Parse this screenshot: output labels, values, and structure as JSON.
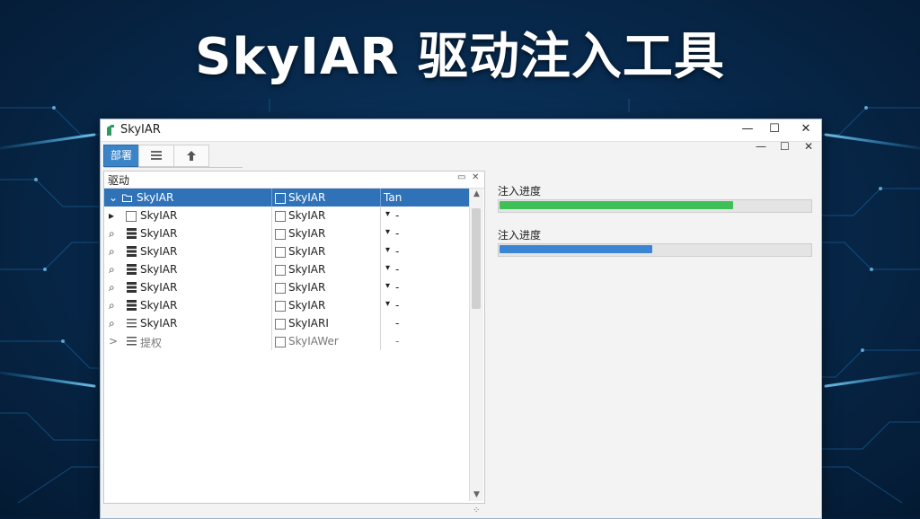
{
  "headline": "SkyIAR 驱动注入工具",
  "window": {
    "title": "SkyIAR",
    "controls": {
      "minimize": "—",
      "maximize": "☐",
      "close": "✕"
    },
    "inner_controls": {
      "minimize": "—",
      "maximize": "☐",
      "close": "✕"
    }
  },
  "toolbar": {
    "tabs": [
      {
        "label": "部署",
        "icon": null,
        "active": true
      },
      {
        "label": "",
        "icon": "list-icon",
        "active": false
      },
      {
        "label": "",
        "icon": "upload-icon",
        "active": false
      }
    ]
  },
  "driver_panel": {
    "title": "驱动",
    "controls": {
      "pin": "▭",
      "close": "✕"
    },
    "rows": [
      {
        "expander": "⌄",
        "icon": "folder-icon",
        "name": "SkyIAR",
        "col2": "SkyIAR",
        "col3": "Tan",
        "dropdown": "",
        "dash": "",
        "selected": true
      },
      {
        "expander": "▸",
        "icon": "checkbox",
        "name": "SkyIAR",
        "col2": "SkyIAR",
        "col3": "",
        "dropdown": "▾",
        "dash": "-",
        "selected": false
      },
      {
        "expander": "⌕",
        "icon": "server-icon",
        "name": "SkyIAR",
        "col2": "SkyIAR",
        "col3": "",
        "dropdown": "▾",
        "dash": "-",
        "selected": false
      },
      {
        "expander": "⌕",
        "icon": "server-icon",
        "name": "SkyIAR",
        "col2": "SkyIAR",
        "col3": "",
        "dropdown": "▾",
        "dash": "-",
        "selected": false
      },
      {
        "expander": "⌕",
        "icon": "server-icon",
        "name": "SkyIAR",
        "col2": "SkyIAR",
        "col3": "",
        "dropdown": "▾",
        "dash": "-",
        "selected": false
      },
      {
        "expander": "⌕",
        "icon": "server-icon",
        "name": "SkyIAR",
        "col2": "SkyIAR",
        "col3": "",
        "dropdown": "▾",
        "dash": "-",
        "selected": false
      },
      {
        "expander": "⌕",
        "icon": "server-icon",
        "name": "SkyIAR",
        "col2": "SkyIAR",
        "col3": "",
        "dropdown": "▾",
        "dash": "-",
        "selected": false
      },
      {
        "expander": "⌕",
        "icon": "list-icon",
        "name": "SkyIAR",
        "col2": "SkyIARI",
        "col3": "",
        "dropdown": "",
        "dash": "-",
        "selected": false
      },
      {
        "expander": ">",
        "icon": "list-icon",
        "name": "提权",
        "col2": "SkyIAWer",
        "col3": "",
        "dropdown": "",
        "dash": "-",
        "selected": false,
        "faded": true
      }
    ],
    "scroll_up": "▲",
    "scroll_down": "▼"
  },
  "progress": [
    {
      "label": "注入进度",
      "percent": 75,
      "color": "#3fbf57"
    },
    {
      "label": "注入进度",
      "percent": 49,
      "color": "#3a86d4"
    }
  ],
  "resize_grip": "⁘"
}
